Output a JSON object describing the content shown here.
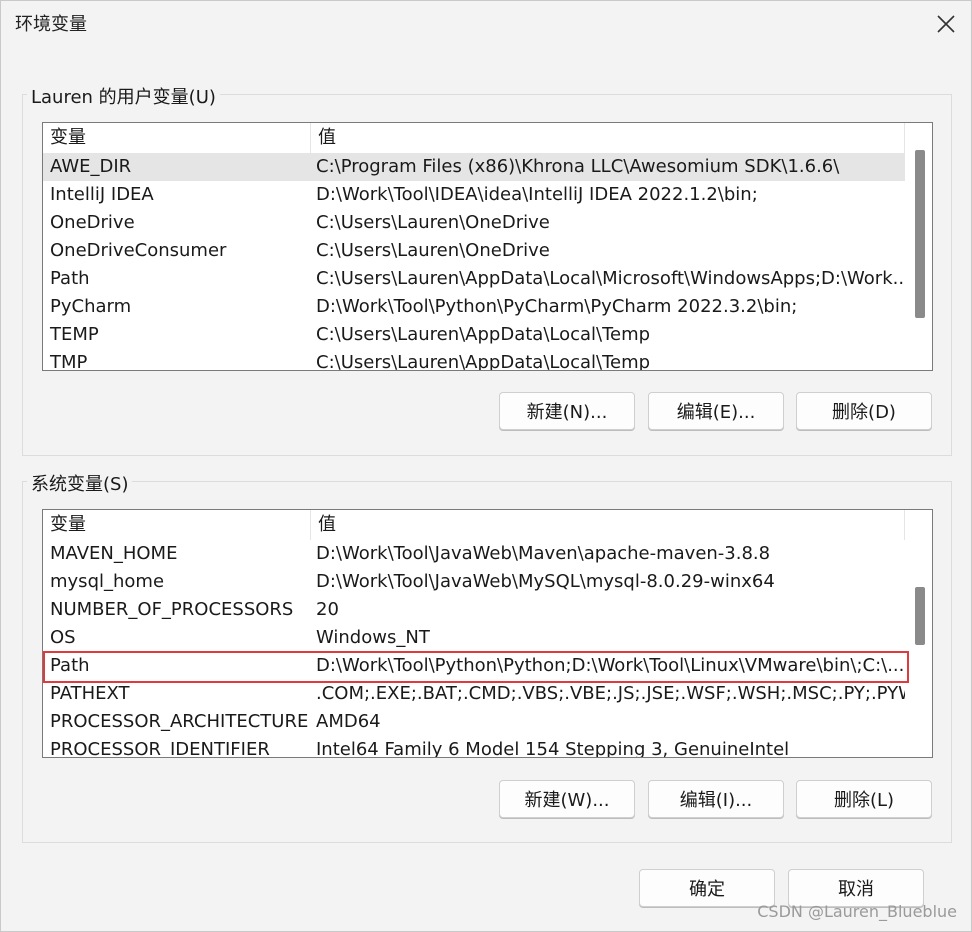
{
  "window": {
    "title": "环境变量"
  },
  "user_vars": {
    "group_label": "Lauren 的用户变量(U)",
    "headers": [
      "变量",
      "值"
    ],
    "rows": [
      {
        "name": "AWE_DIR",
        "value": "C:\\Program Files (x86)\\Khrona LLC\\Awesomium SDK\\1.6.6\\"
      },
      {
        "name": "IntelliJ IDEA",
        "value": "D:\\Work\\Tool\\IDEA\\idea\\IntelliJ IDEA 2022.1.2\\bin;"
      },
      {
        "name": "OneDrive",
        "value": "C:\\Users\\Lauren\\OneDrive"
      },
      {
        "name": "OneDriveConsumer",
        "value": "C:\\Users\\Lauren\\OneDrive"
      },
      {
        "name": "Path",
        "value": "C:\\Users\\Lauren\\AppData\\Local\\Microsoft\\WindowsApps;D:\\Work..."
      },
      {
        "name": "PyCharm",
        "value": "D:\\Work\\Tool\\Python\\PyCharm\\PyCharm 2022.3.2\\bin;"
      },
      {
        "name": "TEMP",
        "value": "C:\\Users\\Lauren\\AppData\\Local\\Temp"
      },
      {
        "name": "TMP",
        "value": "C:\\Users\\Lauren\\AppData\\Local\\Temp"
      }
    ],
    "buttons": {
      "new": "新建(N)...",
      "edit": "编辑(E)...",
      "delete": "删除(D)"
    }
  },
  "system_vars": {
    "group_label": "系统变量(S)",
    "headers": [
      "变量",
      "值"
    ],
    "rows": [
      {
        "name": "MAVEN_HOME",
        "value": "D:\\Work\\Tool\\JavaWeb\\Maven\\apache-maven-3.8.8"
      },
      {
        "name": "mysql_home",
        "value": "D:\\Work\\Tool\\JavaWeb\\MySQL\\mysql-8.0.29-winx64"
      },
      {
        "name": "NUMBER_OF_PROCESSORS",
        "value": "20"
      },
      {
        "name": "OS",
        "value": "Windows_NT"
      },
      {
        "name": "Path",
        "value": "D:\\Work\\Tool\\Python\\Python;D:\\Work\\Tool\\Linux\\VMware\\bin\\;C:\\..."
      },
      {
        "name": "PATHEXT",
        "value": ".COM;.EXE;.BAT;.CMD;.VBS;.VBE;.JS;.JSE;.WSF;.WSH;.MSC;.PY;.PYW"
      },
      {
        "name": "PROCESSOR_ARCHITECTURE",
        "value": "AMD64"
      },
      {
        "name": "PROCESSOR_IDENTIFIER",
        "value": "Intel64 Family 6 Model 154 Stepping 3, GenuineIntel"
      }
    ],
    "buttons": {
      "new": "新建(W)...",
      "edit": "编辑(I)...",
      "delete": "删除(L)"
    }
  },
  "footer": {
    "ok": "确定",
    "cancel": "取消"
  },
  "watermark": "CSDN @Lauren_Blueblue",
  "colors": {
    "highlight": "#e0393e",
    "selected_row": "#e5e5e5"
  },
  "icons": {
    "close": "close-icon"
  }
}
